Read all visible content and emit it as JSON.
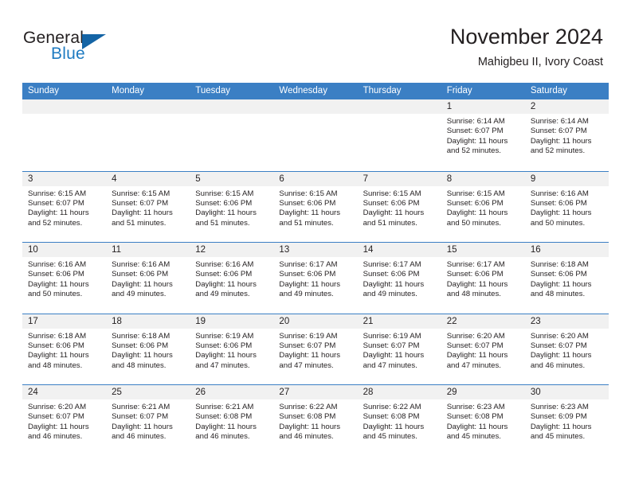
{
  "brand": {
    "name_part1": "General",
    "name_part2": "Blue"
  },
  "header": {
    "title": "November 2024",
    "location": "Mahigbeu II, Ivory Coast"
  },
  "colors": {
    "header_blue": "#3b7fc4",
    "brand_blue": "#1f7bc1",
    "triangle_blue": "#1464a5",
    "day_band": "#f1f1f1",
    "text": "#231f20"
  },
  "calendar": {
    "weekdays": [
      "Sunday",
      "Monday",
      "Tuesday",
      "Wednesday",
      "Thursday",
      "Friday",
      "Saturday"
    ],
    "labels": {
      "sunrise": "Sunrise:",
      "sunset": "Sunset:",
      "daylight": "Daylight:"
    },
    "weeks": [
      [
        {
          "day": "",
          "empty": true
        },
        {
          "day": "",
          "empty": true
        },
        {
          "day": "",
          "empty": true
        },
        {
          "day": "",
          "empty": true
        },
        {
          "day": "",
          "empty": true
        },
        {
          "day": "1",
          "sunrise": "Sunrise: 6:14 AM",
          "sunset": "Sunset: 6:07 PM",
          "daylight": "Daylight: 11 hours and 52 minutes."
        },
        {
          "day": "2",
          "sunrise": "Sunrise: 6:14 AM",
          "sunset": "Sunset: 6:07 PM",
          "daylight": "Daylight: 11 hours and 52 minutes."
        }
      ],
      [
        {
          "day": "3",
          "sunrise": "Sunrise: 6:15 AM",
          "sunset": "Sunset: 6:07 PM",
          "daylight": "Daylight: 11 hours and 52 minutes."
        },
        {
          "day": "4",
          "sunrise": "Sunrise: 6:15 AM",
          "sunset": "Sunset: 6:07 PM",
          "daylight": "Daylight: 11 hours and 51 minutes."
        },
        {
          "day": "5",
          "sunrise": "Sunrise: 6:15 AM",
          "sunset": "Sunset: 6:06 PM",
          "daylight": "Daylight: 11 hours and 51 minutes."
        },
        {
          "day": "6",
          "sunrise": "Sunrise: 6:15 AM",
          "sunset": "Sunset: 6:06 PM",
          "daylight": "Daylight: 11 hours and 51 minutes."
        },
        {
          "day": "7",
          "sunrise": "Sunrise: 6:15 AM",
          "sunset": "Sunset: 6:06 PM",
          "daylight": "Daylight: 11 hours and 51 minutes."
        },
        {
          "day": "8",
          "sunrise": "Sunrise: 6:15 AM",
          "sunset": "Sunset: 6:06 PM",
          "daylight": "Daylight: 11 hours and 50 minutes."
        },
        {
          "day": "9",
          "sunrise": "Sunrise: 6:16 AM",
          "sunset": "Sunset: 6:06 PM",
          "daylight": "Daylight: 11 hours and 50 minutes."
        }
      ],
      [
        {
          "day": "10",
          "sunrise": "Sunrise: 6:16 AM",
          "sunset": "Sunset: 6:06 PM",
          "daylight": "Daylight: 11 hours and 50 minutes."
        },
        {
          "day": "11",
          "sunrise": "Sunrise: 6:16 AM",
          "sunset": "Sunset: 6:06 PM",
          "daylight": "Daylight: 11 hours and 49 minutes."
        },
        {
          "day": "12",
          "sunrise": "Sunrise: 6:16 AM",
          "sunset": "Sunset: 6:06 PM",
          "daylight": "Daylight: 11 hours and 49 minutes."
        },
        {
          "day": "13",
          "sunrise": "Sunrise: 6:17 AM",
          "sunset": "Sunset: 6:06 PM",
          "daylight": "Daylight: 11 hours and 49 minutes."
        },
        {
          "day": "14",
          "sunrise": "Sunrise: 6:17 AM",
          "sunset": "Sunset: 6:06 PM",
          "daylight": "Daylight: 11 hours and 49 minutes."
        },
        {
          "day": "15",
          "sunrise": "Sunrise: 6:17 AM",
          "sunset": "Sunset: 6:06 PM",
          "daylight": "Daylight: 11 hours and 48 minutes."
        },
        {
          "day": "16",
          "sunrise": "Sunrise: 6:18 AM",
          "sunset": "Sunset: 6:06 PM",
          "daylight": "Daylight: 11 hours and 48 minutes."
        }
      ],
      [
        {
          "day": "17",
          "sunrise": "Sunrise: 6:18 AM",
          "sunset": "Sunset: 6:06 PM",
          "daylight": "Daylight: 11 hours and 48 minutes."
        },
        {
          "day": "18",
          "sunrise": "Sunrise: 6:18 AM",
          "sunset": "Sunset: 6:06 PM",
          "daylight": "Daylight: 11 hours and 48 minutes."
        },
        {
          "day": "19",
          "sunrise": "Sunrise: 6:19 AM",
          "sunset": "Sunset: 6:06 PM",
          "daylight": "Daylight: 11 hours and 47 minutes."
        },
        {
          "day": "20",
          "sunrise": "Sunrise: 6:19 AM",
          "sunset": "Sunset: 6:07 PM",
          "daylight": "Daylight: 11 hours and 47 minutes."
        },
        {
          "day": "21",
          "sunrise": "Sunrise: 6:19 AM",
          "sunset": "Sunset: 6:07 PM",
          "daylight": "Daylight: 11 hours and 47 minutes."
        },
        {
          "day": "22",
          "sunrise": "Sunrise: 6:20 AM",
          "sunset": "Sunset: 6:07 PM",
          "daylight": "Daylight: 11 hours and 47 minutes."
        },
        {
          "day": "23",
          "sunrise": "Sunrise: 6:20 AM",
          "sunset": "Sunset: 6:07 PM",
          "daylight": "Daylight: 11 hours and 46 minutes."
        }
      ],
      [
        {
          "day": "24",
          "sunrise": "Sunrise: 6:20 AM",
          "sunset": "Sunset: 6:07 PM",
          "daylight": "Daylight: 11 hours and 46 minutes."
        },
        {
          "day": "25",
          "sunrise": "Sunrise: 6:21 AM",
          "sunset": "Sunset: 6:07 PM",
          "daylight": "Daylight: 11 hours and 46 minutes."
        },
        {
          "day": "26",
          "sunrise": "Sunrise: 6:21 AM",
          "sunset": "Sunset: 6:08 PM",
          "daylight": "Daylight: 11 hours and 46 minutes."
        },
        {
          "day": "27",
          "sunrise": "Sunrise: 6:22 AM",
          "sunset": "Sunset: 6:08 PM",
          "daylight": "Daylight: 11 hours and 46 minutes."
        },
        {
          "day": "28",
          "sunrise": "Sunrise: 6:22 AM",
          "sunset": "Sunset: 6:08 PM",
          "daylight": "Daylight: 11 hours and 45 minutes."
        },
        {
          "day": "29",
          "sunrise": "Sunrise: 6:23 AM",
          "sunset": "Sunset: 6:08 PM",
          "daylight": "Daylight: 11 hours and 45 minutes."
        },
        {
          "day": "30",
          "sunrise": "Sunrise: 6:23 AM",
          "sunset": "Sunset: 6:09 PM",
          "daylight": "Daylight: 11 hours and 45 minutes."
        }
      ]
    ]
  }
}
